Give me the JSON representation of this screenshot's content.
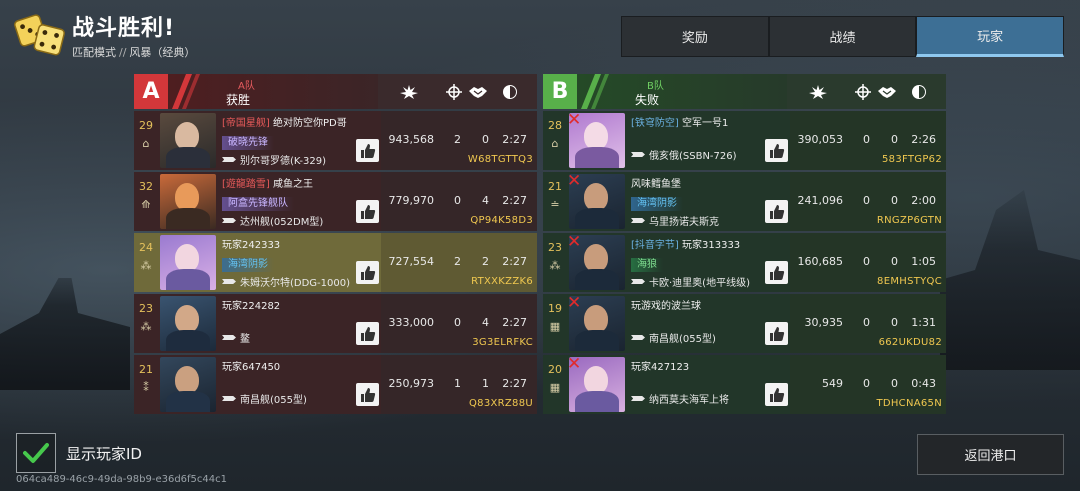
{
  "header": {
    "title": "战斗胜利!",
    "mode": "匹配模式",
    "separator": "//",
    "map": "风暴（经典）"
  },
  "tabs": [
    {
      "label": "奖励",
      "active": false
    },
    {
      "label": "战绩",
      "active": false
    },
    {
      "label": "玩家",
      "active": true
    }
  ],
  "team_a": {
    "badge": "A",
    "label": "A队",
    "result": "获胜",
    "players": [
      {
        "rank": "29",
        "guild": "[帝国星舰]",
        "name": "绝对防空你PD哥",
        "title": "破晓先锋",
        "title_style": "purple",
        "ship": "别尔哥罗德(K-329)",
        "score": "943,568",
        "kills": "2",
        "assists": "0",
        "time": "2:27",
        "id": "W68TGTTQ3",
        "highlight": false,
        "dead": false
      },
      {
        "rank": "32",
        "guild": "[遊龍踏雪]",
        "name": "咸鱼之王",
        "title": "阿盒先锋舰队",
        "title_style": "purple",
        "ship": "达州舰(052DM型)",
        "score": "779,970",
        "kills": "0",
        "assists": "4",
        "time": "2:27",
        "id": "QP94K58D3",
        "highlight": false,
        "dead": false
      },
      {
        "rank": "24",
        "guild": "",
        "name": "玩家242333",
        "title": "海湾阴影",
        "title_style": "blue",
        "ship": "朱姆沃尔特(DDG-1000)",
        "score": "727,554",
        "kills": "2",
        "assists": "2",
        "time": "2:27",
        "id": "RTXXKZZK6",
        "highlight": true,
        "dead": false
      },
      {
        "rank": "23",
        "guild": "",
        "name": "玩家224282",
        "title": "",
        "title_style": "",
        "ship": "鳌",
        "score": "333,000",
        "kills": "0",
        "assists": "4",
        "time": "2:27",
        "id": "3G3ELRFKC",
        "highlight": false,
        "dead": false
      },
      {
        "rank": "21",
        "guild": "",
        "name": "玩家647450",
        "title": "",
        "title_style": "",
        "ship": "南昌舰(055型)",
        "score": "250,973",
        "kills": "1",
        "assists": "1",
        "time": "2:27",
        "id": "Q83XRZ88U",
        "highlight": false,
        "dead": false
      }
    ]
  },
  "team_b": {
    "badge": "B",
    "label": "B队",
    "result": "失败",
    "players": [
      {
        "rank": "28",
        "guild": "[铁穹防空]",
        "name": "空军一号1",
        "title": "",
        "title_style": "",
        "ship": "俄亥俄(SSBN-726)",
        "score": "390,053",
        "kills": "0",
        "assists": "0",
        "time": "2:26",
        "id": "583FTGP62",
        "highlight": false,
        "dead": true
      },
      {
        "rank": "21",
        "guild": "",
        "name": "风味鳕鱼堡",
        "title": "海湾阴影",
        "title_style": "blue",
        "ship": "乌里扬诺夫斯克",
        "score": "241,096",
        "kills": "0",
        "assists": "0",
        "time": "2:00",
        "id": "RNGZP6GTN",
        "highlight": false,
        "dead": true
      },
      {
        "rank": "23",
        "guild": "[抖音字节]",
        "name": "玩家313333",
        "title": "海狼",
        "title_style": "green",
        "ship": "卡欧·迪里奥(地平线级)",
        "score": "160,685",
        "kills": "0",
        "assists": "0",
        "time": "1:05",
        "id": "8EMHSTYQC",
        "highlight": false,
        "dead": true
      },
      {
        "rank": "19",
        "guild": "",
        "name": "玩游戏的波兰球",
        "title": "",
        "title_style": "",
        "ship": "南昌舰(055型)",
        "score": "30,935",
        "kills": "0",
        "assists": "0",
        "time": "1:31",
        "id": "662UKDU82",
        "highlight": false,
        "dead": true
      },
      {
        "rank": "20",
        "guild": "",
        "name": "玩家427123",
        "title": "",
        "title_style": "",
        "ship": "纳西莫夫海军上将",
        "score": "549",
        "kills": "0",
        "assists": "0",
        "time": "0:43",
        "id": "TDHCNA65N",
        "highlight": false,
        "dead": true
      }
    ]
  },
  "footer": {
    "show_id_label": "显示玩家ID",
    "show_id_checked": true,
    "session_id": "064ca489-46c9-49da-98b9-e36d6f5c44c1",
    "back_label": "返回港口"
  },
  "icons": {
    "dice": "dice-icon",
    "score": "explosion-icon",
    "kills": "crosshair-icon",
    "assists": "handshake-icon",
    "time": "clock-icon",
    "like": "thumbs-up-icon",
    "check": "checkmark-icon"
  },
  "colors": {
    "team_a": "#d3373a",
    "team_b": "#58b04a",
    "active_tab": "#3d6f95",
    "player_id": "#f0c850",
    "rank": "#e4c15c"
  }
}
